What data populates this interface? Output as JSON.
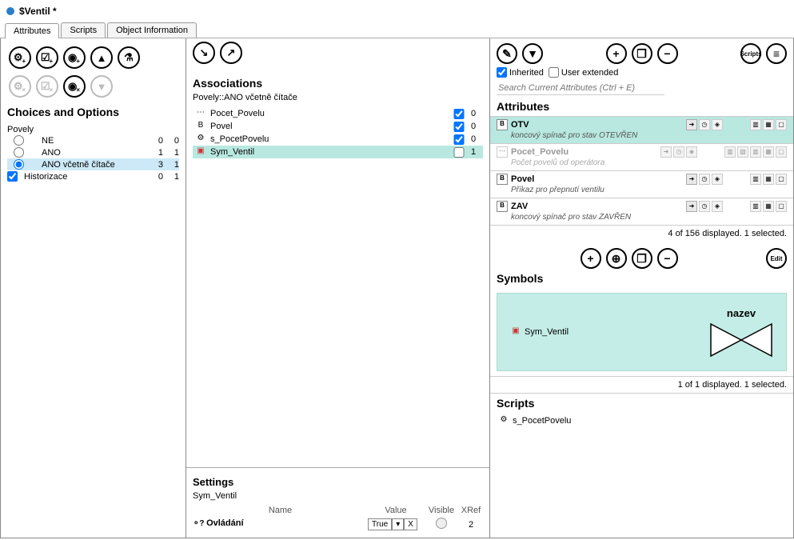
{
  "window": {
    "title": "$Ventil *"
  },
  "tabs": [
    "Attributes",
    "Scripts",
    "Object Information"
  ],
  "activeTab": 0,
  "leftPanel": {
    "heading": "Choices and Options",
    "group": "Povely",
    "options": [
      {
        "label": "NE",
        "c1": "0",
        "c2": "0",
        "selected": false
      },
      {
        "label": "ANO",
        "c1": "1",
        "c2": "1",
        "selected": false
      },
      {
        "label": "ANO včetně čítače",
        "c1": "3",
        "c2": "1",
        "selected": true
      }
    ],
    "checks": [
      {
        "label": "Historizace",
        "c1": "0",
        "c2": "1",
        "checked": true
      }
    ]
  },
  "assoc": {
    "heading": "Associations",
    "subtitle": "Povely::ANO včetně čítače",
    "rows": [
      {
        "icon": "⋯",
        "name": "Pocet_Povelu",
        "checked": true,
        "count": "0"
      },
      {
        "icon": "B",
        "name": "Povel",
        "checked": true,
        "count": "0"
      },
      {
        "icon": "⚙",
        "name": "s_PocetPovelu",
        "checked": true,
        "count": "0"
      },
      {
        "icon": "▣",
        "name": "Sym_Ventil",
        "checked": false,
        "count": "1",
        "selected": true
      }
    ]
  },
  "settings": {
    "heading": "Settings",
    "sub": "Sym_Ventil",
    "cols": {
      "name": "Name",
      "value": "Value",
      "visible": "Visible",
      "xref": "XRef"
    },
    "row": {
      "icon": "⚬?",
      "name": "Ovládání",
      "value": "True",
      "xref": "2"
    }
  },
  "rightFilters": {
    "inherited": {
      "label": "Inherited",
      "checked": true
    },
    "user": {
      "label": "User extended",
      "checked": false
    },
    "searchPlaceholder": "Search Current Attributes (Ctrl + E)"
  },
  "attributes": {
    "heading": "Attributes",
    "items": [
      {
        "icon": "B",
        "name": "OTV",
        "desc": "koncový spínač pro stav OTEVŘEN",
        "selected": true,
        "dim": false
      },
      {
        "icon": "⋯",
        "name": "Pocet_Povelu",
        "desc": "Počet povelů od operátora",
        "selected": false,
        "dim": true
      },
      {
        "icon": "B",
        "name": "Povel",
        "desc": "Příkaz pro přepnutí ventilu",
        "selected": false,
        "dim": false
      },
      {
        "icon": "B",
        "name": "ZAV",
        "desc": "koncový spínač pro stav ZAVŘEN",
        "selected": false,
        "dim": false
      }
    ],
    "status": "4 of 156 displayed. 1 selected."
  },
  "symbols": {
    "heading": "Symbols",
    "item": {
      "icon": "▣",
      "name": "Sym_Ventil",
      "valveLabel": "nazev"
    },
    "status": "1 of 1 displayed. 1 selected.",
    "editLabel": "Edit"
  },
  "scripts": {
    "heading": "Scripts",
    "items": [
      {
        "icon": "⚙",
        "name": "s_PocetPovelu"
      }
    ]
  },
  "scriptsTool": {
    "scriptsLabel": "Scripts"
  }
}
